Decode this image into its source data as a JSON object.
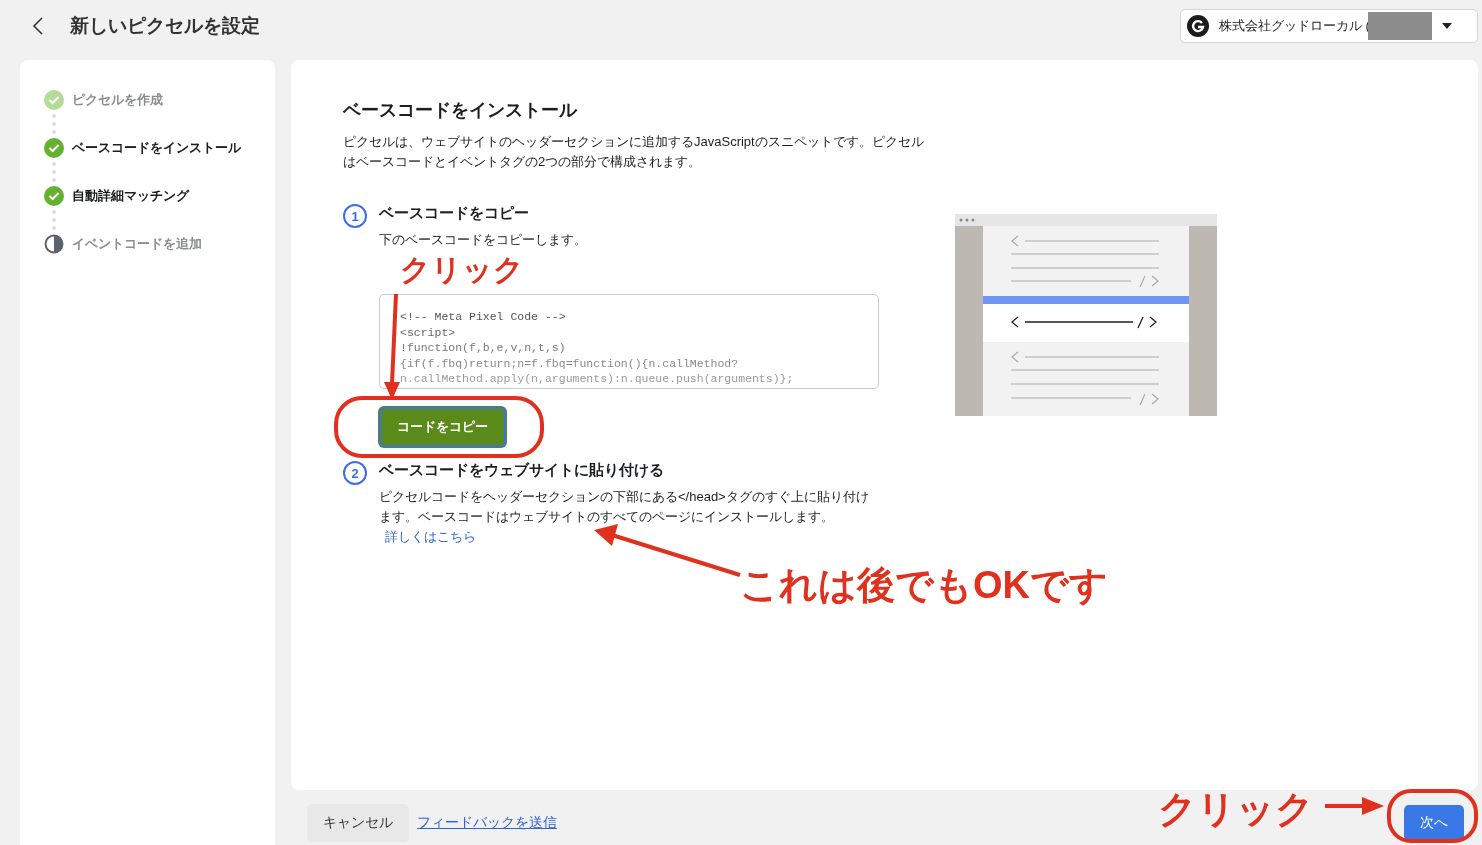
{
  "header": {
    "title": "新しいピクセルを設定",
    "account": {
      "name": "株式会社グッドローカル ("
    }
  },
  "steps": [
    {
      "label": "ピクセルを作成",
      "completed": true,
      "highlighted": false
    },
    {
      "label": "ベースコードをインストール",
      "completed": true,
      "highlighted": true
    },
    {
      "label": "自動詳細マッチング",
      "completed": true,
      "highlighted": true
    },
    {
      "label": "イベントコードを追加",
      "completed": false,
      "highlighted": false
    }
  ],
  "main": {
    "title": "ベースコードをインストール",
    "description": "ピクセルは、ウェブサイトのヘッダーセクションに追加するJavaScriptのスニペットです。ピクセルはベースコードとイベントタグの2つの部分で構成されます。",
    "step1": {
      "number": "1",
      "title": "ベースコードをコピー",
      "text": "下のベースコードをコピーします。",
      "code_lines": [
        "<!-- Meta Pixel Code -->",
        "<script>",
        "!function(f,b,e,v,n,t,s)",
        "{if(f.fbq)return;n=f.fbq=function(){n.callMethod?",
        "n.callMethod.apply(n,arguments):n.queue.push(arguments)};"
      ],
      "button": "コードをコピー"
    },
    "step2": {
      "number": "2",
      "title": "ベースコードをウェブサイトに貼り付ける",
      "text": "ピクセルコードをヘッダーセクションの下部にある</head>タグのすぐ上に貼り付けます。ベースコードはウェブサイトのすべてのページにインストールします。",
      "link": "詳しくはこちら"
    }
  },
  "footer": {
    "cancel": "キャンセル",
    "feedback": "フィードバックを送信",
    "next": "次へ"
  },
  "annotations": [
    {
      "kind": "click-copy",
      "text": "クリック"
    },
    {
      "kind": "later",
      "text": "これは後でもOKです"
    },
    {
      "kind": "click-next",
      "text": "クリック"
    }
  ]
}
